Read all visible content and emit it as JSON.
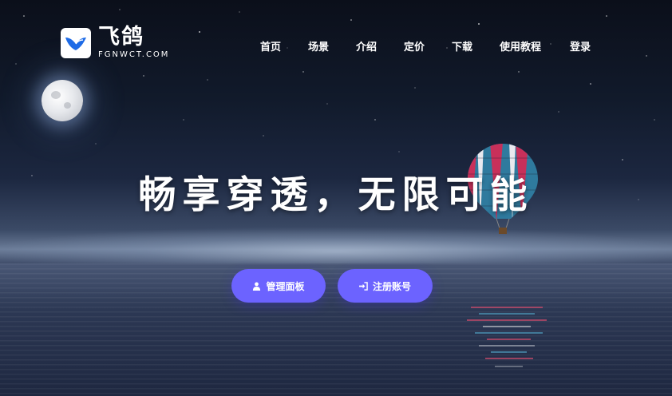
{
  "brand": {
    "name": "飞鸽",
    "domain": "FGNWCT.COM",
    "logo_color": "#1e6be6"
  },
  "nav": {
    "items": [
      {
        "label": "首页"
      },
      {
        "label": "场景"
      },
      {
        "label": "介绍"
      },
      {
        "label": "定价"
      },
      {
        "label": "下载"
      },
      {
        "label": "使用教程"
      },
      {
        "label": "登录"
      }
    ]
  },
  "hero": {
    "title": "畅享穿透，无限可能"
  },
  "actions": {
    "panel_label": "管理面板",
    "panel_icon": "user-icon",
    "register_label": "注册账号",
    "register_icon": "sign-in-icon",
    "button_color": "#6c63ff"
  }
}
